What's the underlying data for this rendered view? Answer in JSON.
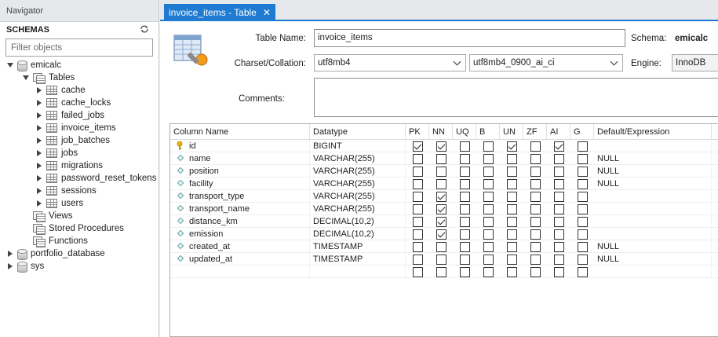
{
  "navigator": {
    "title": "Navigator",
    "schemas_title": "SCHEMAS",
    "filter_placeholder": "Filter objects",
    "tree": {
      "schema": "emicalc",
      "tables_label": "Tables",
      "tables": [
        "cache",
        "cache_locks",
        "failed_jobs",
        "invoice_items",
        "job_batches",
        "jobs",
        "migrations",
        "password_reset_tokens",
        "sessions",
        "users"
      ],
      "views_label": "Views",
      "procedures_label": "Stored Procedures",
      "functions_label": "Functions",
      "other_schemas": [
        "portfolio_database",
        "sys"
      ]
    }
  },
  "tab": {
    "label": "invoice_items - Table",
    "close": "✕"
  },
  "editor": {
    "table_name_label": "Table Name:",
    "table_name_value": "invoice_items",
    "schema_label": "Schema:",
    "schema_value": "emicalc",
    "charset_label": "Charset/Collation:",
    "charset_value": "utf8mb4",
    "collation_value": "utf8mb4_0900_ai_ci",
    "engine_label": "Engine:",
    "engine_value": "InnoDB",
    "comments_label": "Comments:",
    "comments_value": ""
  },
  "grid": {
    "headers": [
      "Column Name",
      "Datatype",
      "PK",
      "NN",
      "UQ",
      "B",
      "UN",
      "ZF",
      "AI",
      "G",
      "Default/Expression"
    ],
    "rows": [
      {
        "name": "id",
        "type": "BIGINT",
        "key": true,
        "flags": [
          true,
          true,
          false,
          false,
          true,
          false,
          true,
          false
        ],
        "default": ""
      },
      {
        "name": "name",
        "type": "VARCHAR(255)",
        "key": false,
        "flags": [
          false,
          false,
          false,
          false,
          false,
          false,
          false,
          false
        ],
        "default": "NULL"
      },
      {
        "name": "position",
        "type": "VARCHAR(255)",
        "key": false,
        "flags": [
          false,
          false,
          false,
          false,
          false,
          false,
          false,
          false
        ],
        "default": "NULL"
      },
      {
        "name": "facility",
        "type": "VARCHAR(255)",
        "key": false,
        "flags": [
          false,
          false,
          false,
          false,
          false,
          false,
          false,
          false
        ],
        "default": "NULL"
      },
      {
        "name": "transport_type",
        "type": "VARCHAR(255)",
        "key": false,
        "flags": [
          false,
          true,
          false,
          false,
          false,
          false,
          false,
          false
        ],
        "default": ""
      },
      {
        "name": "transport_name",
        "type": "VARCHAR(255)",
        "key": false,
        "flags": [
          false,
          true,
          false,
          false,
          false,
          false,
          false,
          false
        ],
        "default": ""
      },
      {
        "name": "distance_km",
        "type": "DECIMAL(10,2)",
        "key": false,
        "flags": [
          false,
          true,
          false,
          false,
          false,
          false,
          false,
          false
        ],
        "default": ""
      },
      {
        "name": "emission",
        "type": "DECIMAL(10,2)",
        "key": false,
        "flags": [
          false,
          true,
          false,
          false,
          false,
          false,
          false,
          false
        ],
        "default": ""
      },
      {
        "name": "created_at",
        "type": "TIMESTAMP",
        "key": false,
        "flags": [
          false,
          false,
          false,
          false,
          false,
          false,
          false,
          false
        ],
        "default": "NULL"
      },
      {
        "name": "updated_at",
        "type": "TIMESTAMP",
        "key": false,
        "flags": [
          false,
          false,
          false,
          false,
          false,
          false,
          false,
          false
        ],
        "default": "NULL"
      },
      {
        "name": "",
        "type": "",
        "key": null,
        "flags": [
          false,
          false,
          false,
          false,
          false,
          false,
          false,
          false
        ],
        "default": ""
      }
    ]
  }
}
